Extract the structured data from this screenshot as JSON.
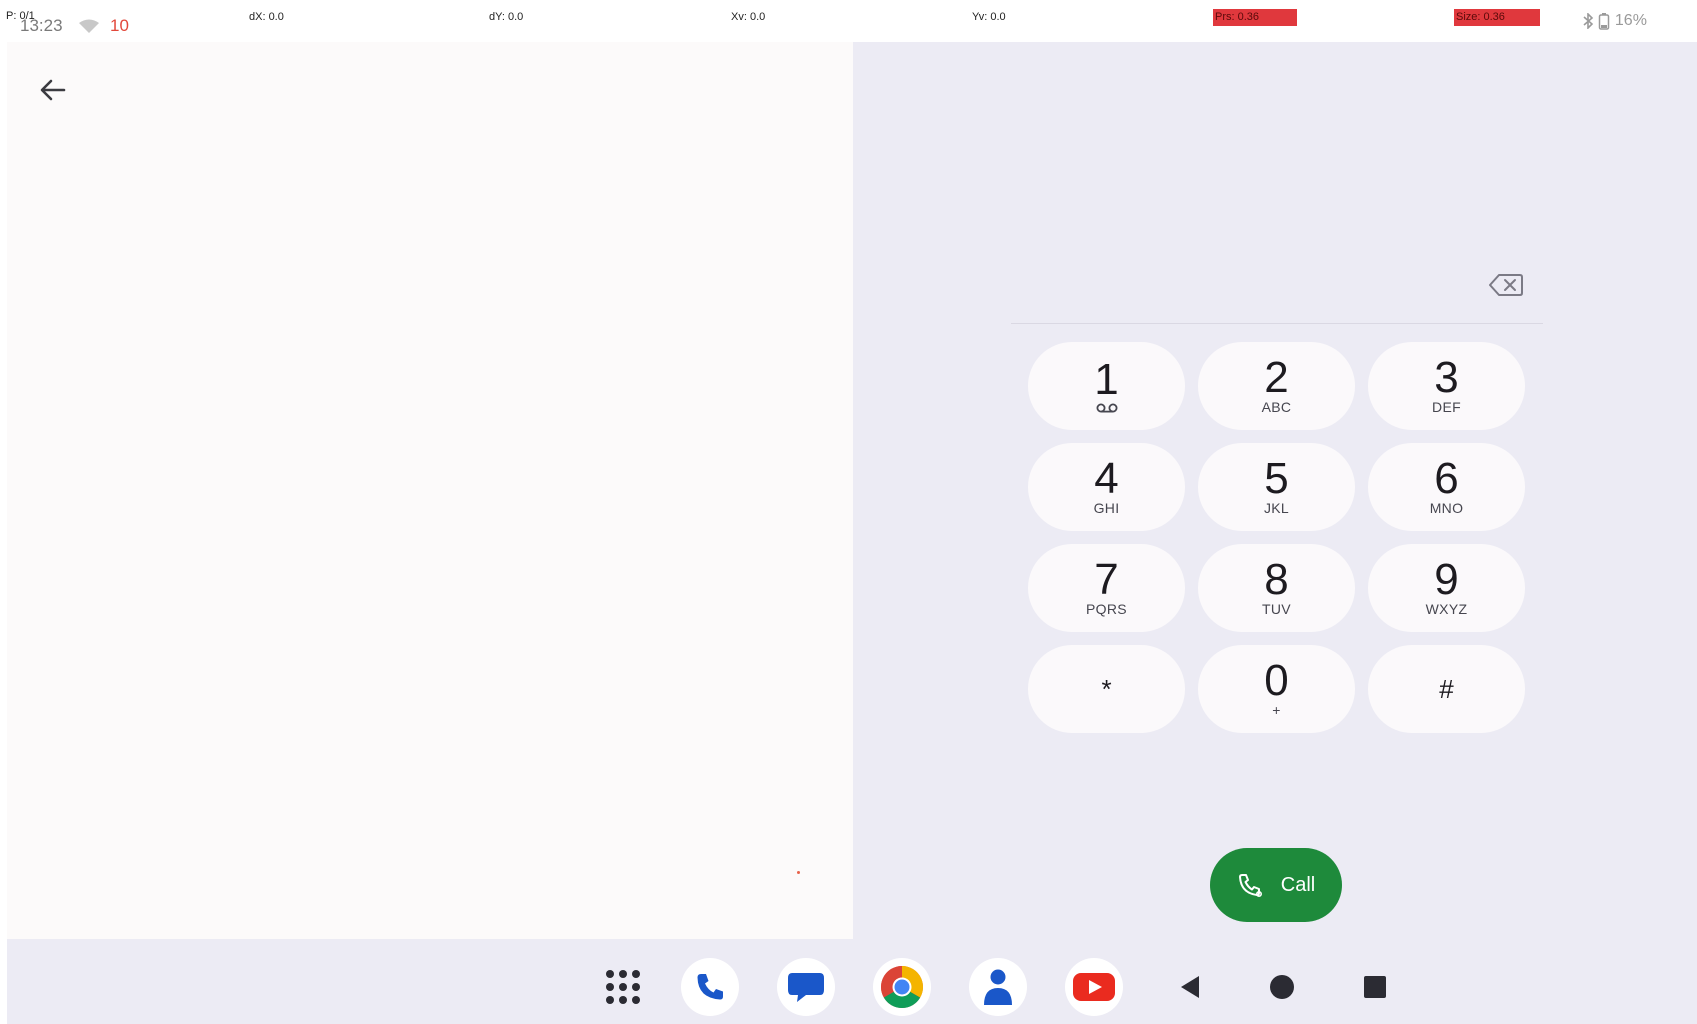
{
  "status_bar": {
    "pointer_label": "P: 0/1",
    "time": "13:23",
    "notification_count": "10",
    "metrics": [
      {
        "label": "dX: 0.0",
        "highlight": false
      },
      {
        "label": "dY: 0.0",
        "highlight": false
      },
      {
        "label": "Xv: 0.0",
        "highlight": false
      },
      {
        "label": "Yv: 0.0",
        "highlight": false
      },
      {
        "label": "Prs: 0.36",
        "highlight": true
      },
      {
        "label": "Size: 0.36",
        "highlight": true
      }
    ],
    "battery_text": "16%"
  },
  "dialer": {
    "digits_value": "",
    "keys": [
      {
        "digit": "1",
        "letters": "",
        "voicemail": true
      },
      {
        "digit": "2",
        "letters": "ABC"
      },
      {
        "digit": "3",
        "letters": "DEF"
      },
      {
        "digit": "4",
        "letters": "GHI"
      },
      {
        "digit": "5",
        "letters": "JKL"
      },
      {
        "digit": "6",
        "letters": "MNO"
      },
      {
        "digit": "7",
        "letters": "PQRS"
      },
      {
        "digit": "8",
        "letters": "TUV"
      },
      {
        "digit": "9",
        "letters": "WXYZ"
      },
      {
        "symbol": "*",
        "letters": ""
      },
      {
        "digit": "0",
        "letters": "+"
      },
      {
        "symbol": "#",
        "letters": ""
      }
    ],
    "call_label": "Call"
  },
  "taskbar": {
    "apps": [
      "app-drawer-icon",
      "phone-icon",
      "messages-icon",
      "chrome-icon",
      "contacts-icon",
      "youtube-icon"
    ],
    "nav": [
      "back-nav-icon",
      "home-nav-icon",
      "recents-nav-icon"
    ]
  },
  "colors": {
    "left_pane_bg": "#fcfafa",
    "right_pane_bg": "#ecebf4",
    "key_bg": "#fbf9fb",
    "call_green": "#1e8a3b",
    "highlight_red": "#e0383d"
  }
}
